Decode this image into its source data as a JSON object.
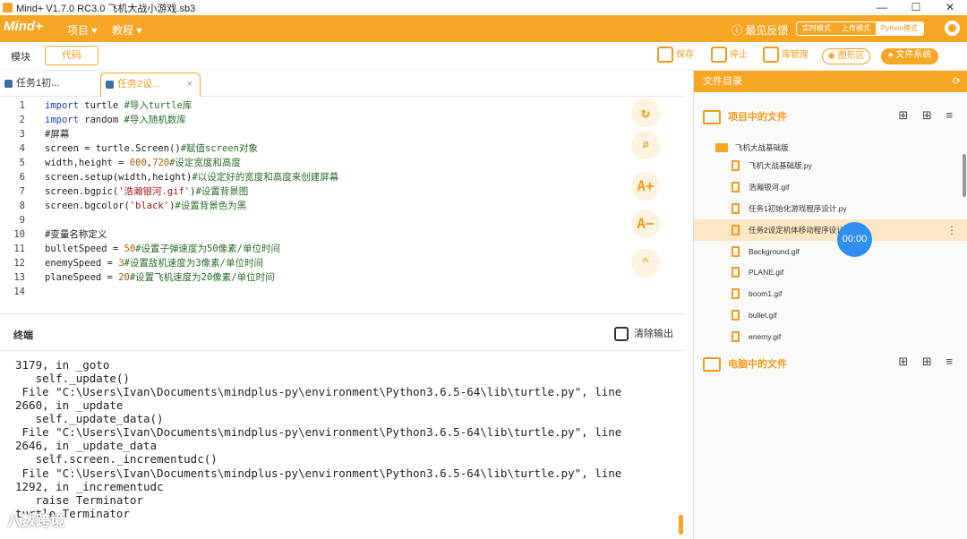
{
  "window": {
    "title": "Mind+ V1.7.0 RC3.0   飞机大战小游戏.sb3",
    "controls": [
      "—",
      "☐",
      "✕"
    ]
  },
  "menubar": {
    "brand": "Mind+",
    "menus": [
      "项目 ▾",
      "教程 ▾"
    ],
    "feedback": "最见反馈",
    "modes": [
      "实时模式",
      "上传模式",
      "Python模式"
    ],
    "active_mode": "Python模式"
  },
  "toolrow": {
    "module_tab": "模块",
    "code_tab": "代码",
    "buttons": [
      "保存",
      "停止",
      "库管理"
    ],
    "pills": [
      "图形区",
      "文件系统"
    ]
  },
  "editor_tabs": [
    {
      "label": "任务1初...",
      "active": false
    },
    {
      "label": "任务2设...",
      "active": true,
      "close": "×"
    }
  ],
  "code": [
    {
      "n": "1",
      "text": "import turtle #导入turtle库"
    },
    {
      "n": "2",
      "text": "import random #导入随机数库"
    },
    {
      "n": "3",
      "text": "#屏幕"
    },
    {
      "n": "4",
      "text": "screen = turtle.Screen()#赋值screen对象"
    },
    {
      "n": "5",
      "text": "width,height = 600,720#设定宽度和高度"
    },
    {
      "n": "6",
      "text": "screen.setup(width,height)#以设定好的宽度和高度来创建屏幕"
    },
    {
      "n": "7",
      "text": "screen.bgpic('浩瀚银河.gif')#设置背景图"
    },
    {
      "n": "8",
      "text": "screen.bgcolor('black')#设置背景色为黑"
    },
    {
      "n": "9",
      "text": ""
    },
    {
      "n": "10",
      "text": "#变量名称定义"
    },
    {
      "n": "11",
      "text": "bulletSpeed = 50#设置子弹速度为50像素/单位时间"
    },
    {
      "n": "12",
      "text": "enemySpeed = 3#设置敌机速度为3像素/单位时间"
    },
    {
      "n": "13",
      "text": "planeSpeed = 20#设置飞机速度为20像素/单位时间"
    },
    {
      "n": "14",
      "text": ""
    }
  ],
  "editor_tools": [
    "↻",
    "⌕",
    "A+",
    "A−",
    "⌃"
  ],
  "terminal": {
    "title": "终端",
    "clear_label": "清除输出",
    "lines": [
      "3179, in _goto",
      "   self._update()",
      " File \"C:\\Users\\Ivan\\Documents\\mindplus-py\\environment\\Python3.6.5-64\\lib\\turtle.py\", line",
      "2660, in _update",
      "   self._update_data()",
      " File \"C:\\Users\\Ivan\\Documents\\mindplus-py\\environment\\Python3.6.5-64\\lib\\turtle.py\", line",
      "2646, in _update_data",
      "   self.screen._incrementudc()",
      " File \"C:\\Users\\Ivan\\Documents\\mindplus-py\\environment\\Python3.6.5-64\\lib\\turtle.py\", line",
      "1292, in _incrementudc",
      "   raise Terminator",
      "turtle.Terminator"
    ]
  },
  "file_panel": {
    "title": "文件目录",
    "refresh_icon": "⟳",
    "project_section": "项目中的文件",
    "computer_section": "电脑中的文件",
    "section_actions": "⊞ ⊞ ≡",
    "folder": "飞机大战基础版",
    "files": [
      {
        "name": "飞机大战基础版.py",
        "selected": false
      },
      {
        "name": "浩瀚银河.gif",
        "selected": false
      },
      {
        "name": "任务1初始化游戏程序设计.py",
        "selected": false
      },
      {
        "name": "任务2设定机体移动程序设计.py",
        "selected": true
      },
      {
        "name": "Background.gif",
        "selected": false
      },
      {
        "name": "PLANE.gif",
        "selected": false
      },
      {
        "name": "boom1.gif",
        "selected": false
      },
      {
        "name": "bullet.gif",
        "selected": false
      },
      {
        "name": "enemy.gif",
        "selected": false
      }
    ],
    "more_icon": "⋮"
  },
  "timer": "00:00",
  "watermark": "八数跨境",
  "colors": {
    "accent": "#f6a623",
    "accent_dark": "#f29b1d",
    "selected_row": "#fde7c4",
    "timer": "#2f8ff0"
  }
}
